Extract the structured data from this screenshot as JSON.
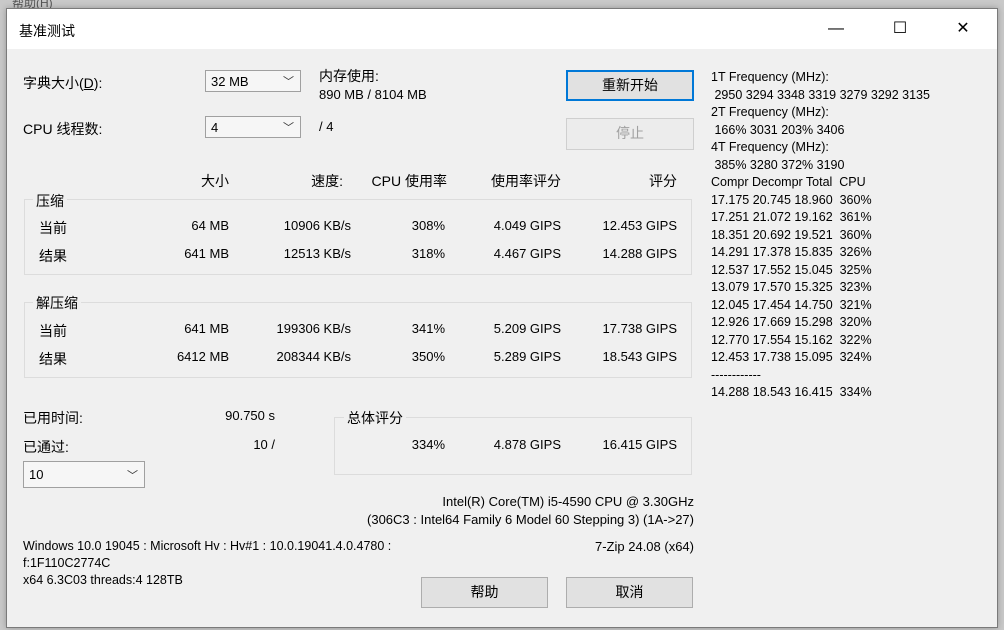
{
  "background_menu": "帮助(H)",
  "window": {
    "title": "基准测试",
    "minimize_glyph": "—",
    "maximize_glyph": "☐",
    "close_glyph": "✕"
  },
  "dict_size": {
    "label": "字典大小",
    "accel": "D",
    "value": "32 MB"
  },
  "threads": {
    "label": "CPU 线程数:",
    "value": "4",
    "of": "/ 4"
  },
  "memory": {
    "label": "内存使用:",
    "value": "890 MB / 8104 MB"
  },
  "buttons": {
    "restart": "重新开始",
    "stop": "停止",
    "help": "帮助",
    "cancel": "取消"
  },
  "columns": {
    "size": "大小",
    "speed": "速度:",
    "cpu_usage": "CPU 使用率",
    "usage_rating": "使用率评分",
    "rating": "评分"
  },
  "compress": {
    "title": "压缩",
    "rows": [
      {
        "label": "当前",
        "size": "64 MB",
        "speed": "10906 KB/s",
        "usage": "308%",
        "usage_rating": "4.049 GIPS",
        "rating": "12.453 GIPS"
      },
      {
        "label": "结果",
        "size": "641 MB",
        "speed": "12513 KB/s",
        "usage": "318%",
        "usage_rating": "4.467 GIPS",
        "rating": "14.288 GIPS"
      }
    ]
  },
  "decompress": {
    "title": "解压缩",
    "rows": [
      {
        "label": "当前",
        "size": "641 MB",
        "speed": "199306 KB/s",
        "usage": "341%",
        "usage_rating": "5.209 GIPS",
        "rating": "17.738 GIPS"
      },
      {
        "label": "结果",
        "size": "6412 MB",
        "speed": "208344 KB/s",
        "usage": "350%",
        "usage_rating": "5.289 GIPS",
        "rating": "18.543 GIPS"
      }
    ]
  },
  "elapsed": {
    "label": "已用时间:",
    "value": "90.750 s"
  },
  "passed": {
    "label": "已通过:",
    "value": "10 /",
    "combo_value": "10"
  },
  "total": {
    "title": "总体评分",
    "usage": "334%",
    "usage_rating": "4.878 GIPS",
    "rating": "16.415 GIPS"
  },
  "cpu_info": {
    "line1": "Intel(R) Core(TM) i5-4590 CPU @ 3.30GHz",
    "line2": "(306C3 : Intel64 Family 6 Model 60 Stepping 3) (1A->27)"
  },
  "os_info": {
    "line1": "Windows 10.0 19045 : Microsoft Hv : Hv#1 : 10.0.19041.4.0.4780 :",
    "line2": "f:1F110C2774C",
    "line3": "x64 6.3C03 threads:4 128TB",
    "version": "7-Zip 24.08 (x64)"
  },
  "log_lines": [
    "1T Frequency (MHz):",
    " 2950 3294 3348 3319 3279 3292 3135",
    "2T Frequency (MHz):",
    " 166% 3031 203% 3406",
    "4T Frequency (MHz):",
    " 385% 3280 372% 3190",
    "Compr Decompr Total  CPU",
    "17.175 20.745 18.960  360%",
    "17.251 21.072 19.162  361%",
    "18.351 20.692 19.521  360%",
    "14.291 17.378 15.835  326%",
    "12.537 17.552 15.045  325%",
    "13.079 17.570 15.325  323%",
    "12.045 17.454 14.750  321%",
    "12.926 17.669 15.298  320%",
    "12.770 17.554 15.162  322%",
    "12.453 17.738 15.095  324%",
    "------------",
    "14.288 18.543 16.415  334%"
  ]
}
